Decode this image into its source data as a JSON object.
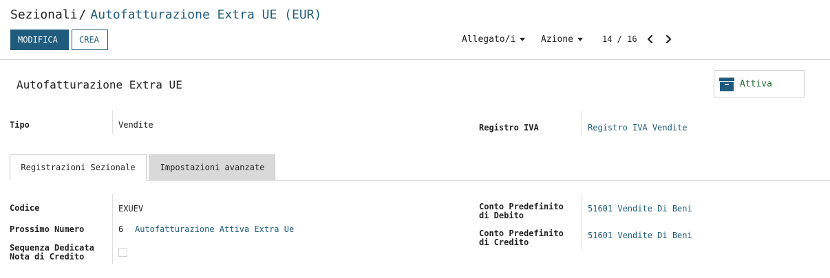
{
  "breadcrumb": {
    "parent": "Sezionali",
    "separator": "/",
    "current": "Autofatturazione Extra UE (EUR)"
  },
  "toolbar": {
    "edit_label": "MODIFICA",
    "create_label": "CREA",
    "attachments_label": "Allegato/i",
    "action_label": "Azione",
    "pager": "14 / 16",
    "prev_icon": "chevron-left-icon",
    "next_icon": "chevron-right-icon"
  },
  "record": {
    "title": "Autofatturazione Extra UE",
    "active_button": {
      "label": "Attiva",
      "icon": "archive-icon",
      "icon_color": "#1f5b7d",
      "label_color": "#1e6b2e"
    }
  },
  "header_fields": {
    "tipo": {
      "label": "Tipo",
      "value": "Vendite"
    },
    "registro_iva": {
      "label": "Registro IVA",
      "value": "Registro IVA Vendite"
    }
  },
  "tabs": [
    {
      "label": "Registrazioni Sezionale",
      "active": true
    },
    {
      "label": "Impostazioni avanzate",
      "active": false
    }
  ],
  "tab_fields": {
    "codice": {
      "label": "Codice",
      "value": "EXUEV"
    },
    "prossimo_numero": {
      "label": "Prossimo Numero",
      "number": "6",
      "sequence": "Autofatturazione Attiva Extra Ue"
    },
    "sequenza_nc": {
      "label_line1": "Sequenza Dedicata",
      "label_line2": "Nota di Credito",
      "checked": false
    },
    "conto_debito": {
      "label_line1": "Conto Predefinito",
      "label_line2": "di Debito",
      "value": "51601 Vendite Di Beni"
    },
    "conto_credito": {
      "label_line1": "Conto Predefinito",
      "label_line2": "di Credito",
      "value": "51601 Vendite Di Beni"
    }
  },
  "colors": {
    "primary": "#1f5b7d",
    "link": "#1f5b7d",
    "success_text": "#1e6b2e"
  }
}
